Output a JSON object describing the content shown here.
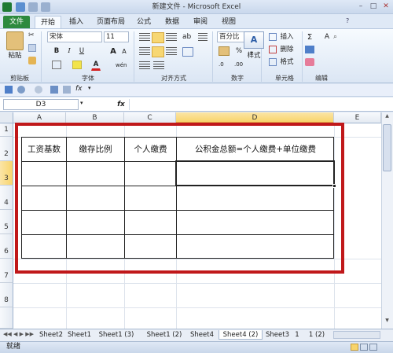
{
  "window": {
    "title": "新建文件 - Microsoft Excel"
  },
  "ribbon_tabs": [
    "文件",
    "开始",
    "插入",
    "页面布局",
    "公式",
    "数据",
    "审阅",
    "视图"
  ],
  "ribbon": {
    "paste_label": "粘贴",
    "font_name": "宋体",
    "font_size": "11",
    "bold": "B",
    "italic": "I",
    "underline": "U",
    "font_grow": "A",
    "font_shrink": "A",
    "font_color": "A",
    "wen": "wén",
    "number_format": "百分比",
    "percent": "%",
    "comma": ",",
    "style_label": "样式",
    "insert_label": "插入",
    "delete_label": "删除",
    "format_label": "格式",
    "sum_symbol": "Σ",
    "sort_symbol": "A",
    "groups": {
      "clipboard": "剪贴板",
      "font": "字体",
      "alignment": "对齐方式",
      "number": "数字",
      "cells": "单元格",
      "editing": "编辑"
    }
  },
  "formula_bar": {
    "name_box": "D3",
    "fx": "fx",
    "content": ""
  },
  "columns": [
    "A",
    "B",
    "C",
    "D",
    "E"
  ],
  "rows": [
    "1",
    "2",
    "3",
    "4",
    "5",
    "6",
    "7",
    "8"
  ],
  "table": {
    "headers": [
      "工资基数",
      "缴存比例",
      "个人缴费",
      "公积金总额=个人缴费+单位缴费"
    ]
  },
  "sheets": [
    "Sheet2",
    "Sheet1",
    "Sheet1 (3)",
    "Sheet1 (2)",
    "Sheet4",
    "Sheet4 (2)",
    "Sheet3",
    "1",
    "1 (2)"
  ],
  "active_sheet": "Sheet4 (2)",
  "status": {
    "ready": "就绪"
  },
  "colors": {
    "accent": "#2d8a3e",
    "highlight_border": "#c0181a",
    "active_col": "#f8d46b"
  }
}
